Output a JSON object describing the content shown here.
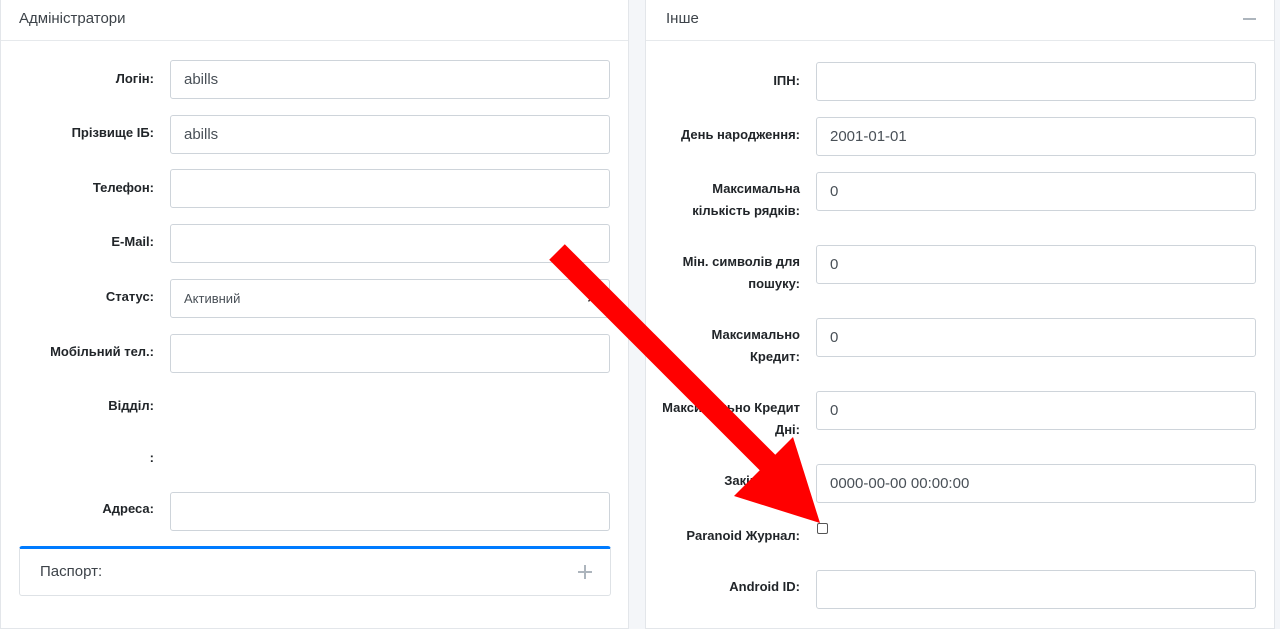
{
  "left": {
    "title": "Адміністратори",
    "fields": {
      "login": {
        "label": "Логін:",
        "value": "abills"
      },
      "fio": {
        "label": "Прізвище ІБ:",
        "value": "abills"
      },
      "phone": {
        "label": "Телефон:",
        "value": ""
      },
      "email": {
        "label": "E-Mail:",
        "value": ""
      },
      "status": {
        "label": "Статус:",
        "value": "Активний",
        "clear": "×"
      },
      "mobile": {
        "label": "Мобільний тел.:",
        "value": ""
      },
      "department": {
        "label": "Відділ:"
      },
      "blank": {
        "label": ":"
      },
      "address": {
        "label": "Адреса:",
        "value": ""
      }
    },
    "passport": {
      "title": "Паспорт:"
    }
  },
  "right": {
    "title": "Інше",
    "fields": {
      "inn": {
        "label": "ІПН:",
        "value": ""
      },
      "birthday": {
        "label": "День народження:",
        "value": "2001-01-01"
      },
      "max_rows": {
        "label": "Максимальна кількість рядків:",
        "value": "0"
      },
      "min_search": {
        "label": "Мін. символів для пошуку:",
        "value": "0"
      },
      "max_credit": {
        "label": "Максимально Кредит:",
        "value": "0"
      },
      "max_credit_days": {
        "label": "Максимально Кредит Дні:",
        "value": "0"
      },
      "expire": {
        "label": "Закінчення:",
        "value": "0000-00-00 00:00:00"
      },
      "paranoid": {
        "label": "Paranoid Журнал:",
        "checked": false
      },
      "android_id": {
        "label": "Android ID:",
        "value": ""
      }
    }
  },
  "annotation": {
    "arrow_color": "#ff0000"
  }
}
